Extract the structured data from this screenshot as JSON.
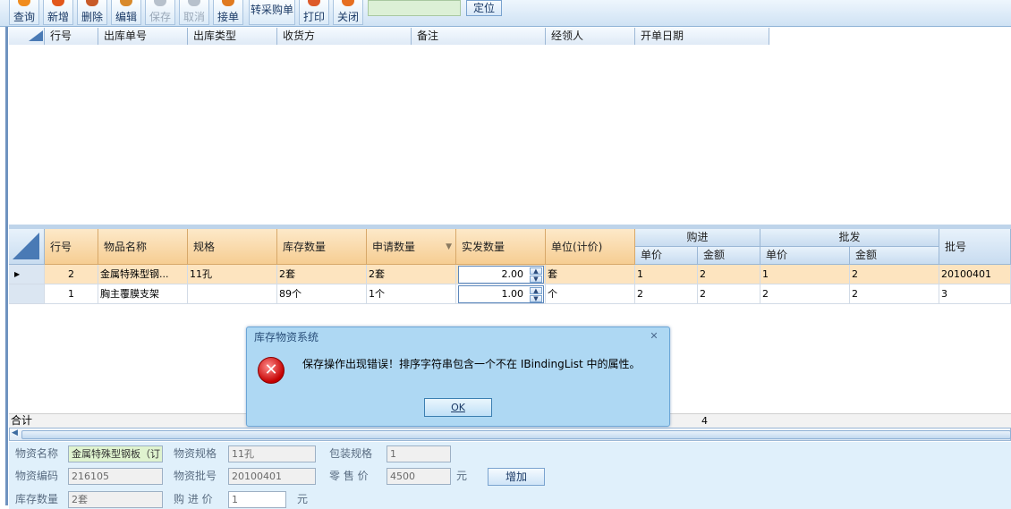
{
  "toolbar": {
    "query": "查询",
    "add": "新增",
    "delete": "删除",
    "edit": "编辑",
    "save": "保存",
    "cancel": "取消",
    "receive": "接单",
    "to_purchase": "转采购单",
    "print": "打印",
    "close": "关闭",
    "locate": "定位",
    "locate_value": ""
  },
  "grid1": {
    "headers": [
      "行号",
      "出库单号",
      "出库类型",
      "收货方",
      "备注",
      "经领人",
      "开单日期"
    ]
  },
  "grid2": {
    "headers": {
      "row_no": "行号",
      "name": "物品名称",
      "spec": "规格",
      "stock": "库存数量",
      "request": "申请数量",
      "actual": "实发数量",
      "unit": "单位(计价)",
      "purchase": "购进",
      "wholesale": "批发",
      "price": "单价",
      "amount": "金额",
      "batch": "批号"
    },
    "rows": [
      {
        "row_no": "2",
        "name": "金属特殊型钢...",
        "spec": "11孔",
        "stock": "2套",
        "request": "2套",
        "actual": "2.00",
        "unit": "套",
        "p_price": "1",
        "p_amount": "2",
        "w_price": "1",
        "w_amount": "2",
        "batch": "20100401"
      },
      {
        "row_no": "1",
        "name": "胸主覆膜支架",
        "spec": "",
        "stock": "89个",
        "request": "1个",
        "actual": "1.00",
        "unit": "个",
        "p_price": "2",
        "p_amount": "2",
        "w_price": "2",
        "w_amount": "2",
        "batch": "3"
      }
    ],
    "totals_label": "合计",
    "totals_value": "4"
  },
  "form": {
    "name_label": "物资名称",
    "name_value": "金属特殊型钢板（订",
    "spec_label": "物资规格",
    "spec_value": "11孔",
    "pack_label": "包装规格",
    "pack_value": "1",
    "code_label": "物资编码",
    "code_value": "216105",
    "batch_label": "物资批号",
    "batch_value": "20100401",
    "retail_label": "零 售 价",
    "retail_value": "4500",
    "retail_unit": "元",
    "add_button": "增加",
    "stock_label": "库存数量",
    "stock_value": "2套",
    "purchase_label": "购 进 价",
    "purchase_value": "1",
    "purchase_unit": "元"
  },
  "dialog": {
    "title": "库存物资系统",
    "message": "保存操作出现错误！排序字符串包含一个不在 IBindingList 中的属性。",
    "ok": "OK"
  }
}
